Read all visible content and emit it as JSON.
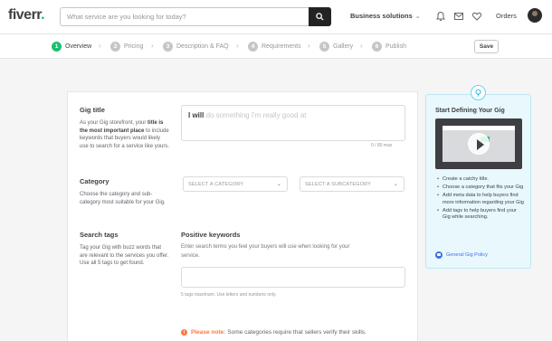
{
  "header": {
    "logo_text": "fiverr",
    "logo_dot": ".",
    "search_placeholder": "What service are you looking for today?",
    "business_solutions": "Business solutions",
    "orders": "Orders"
  },
  "steps": [
    {
      "num": "1",
      "label": "Overview",
      "active": true
    },
    {
      "num": "2",
      "label": "Pricing"
    },
    {
      "num": "3",
      "label": "Description & FAQ"
    },
    {
      "num": "4",
      "label": "Requirements"
    },
    {
      "num": "5",
      "label": "Gallery"
    },
    {
      "num": "6",
      "label": "Publish"
    }
  ],
  "save_label": "Save",
  "gig_title": {
    "heading": "Gig title",
    "desc_pre": "As your Gig storefront, your ",
    "desc_bold": "title is the most important place",
    "desc_post": " to include keywords that buyers would likely use to search for a service like yours.",
    "prefix": "I will",
    "placeholder": "do something I'm really good at",
    "counter": "0 / 80 max"
  },
  "category": {
    "heading": "Category",
    "desc": "Choose the category and sub-category most suitable for your Gig.",
    "select_category": "SELECT A CATEGORY",
    "select_subcategory": "SELECT A SUBCATEGORY"
  },
  "search_tags": {
    "heading": "Search tags",
    "desc": "Tag your Gig with buzz words that are relevant to the services you offer. Use all 5 tags to get found.",
    "kw_heading": "Positive keywords",
    "kw_sub": "Enter search terms you feel your buyers will use when looking for your service.",
    "kw_hint": "5 tags maximum. Use letters and numbers only."
  },
  "note": {
    "label": "Please note:",
    "text": "Some categories require that sellers verify their skills."
  },
  "side": {
    "title": "Start Defining Your Gig",
    "tips": [
      "Create a catchy title.",
      "Choose a category that fits your Gig",
      "Add meta data to help buyers find more information regarding your Gig",
      "Add tags to help buyers find your Gig while searching."
    ],
    "policy": "General Gig Policy"
  },
  "colors": {
    "brand_green": "#1dbf73",
    "warning_orange": "#ff7640",
    "link_blue": "#446ee7",
    "panel_bg": "#e8f8fc"
  }
}
